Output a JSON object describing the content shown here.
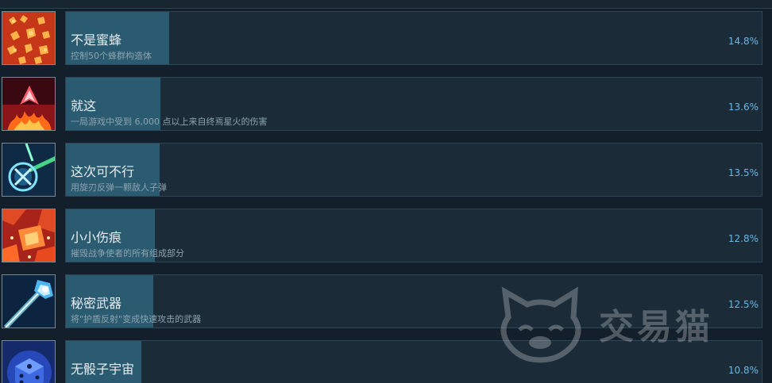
{
  "achievements": [
    {
      "name": "不是蜜蜂",
      "description": "控制50个蜂群构造体",
      "percent": "14.8%",
      "percent_value": 14.8,
      "icon": "swarm-icon",
      "icon_color": "#c8321e"
    },
    {
      "name": "就这",
      "description": "一局游戏中受到 6,000 点以上来自终焉星火的伤害",
      "percent": "13.6%",
      "percent_value": 13.6,
      "icon": "fire-icon",
      "icon_color": "#d02024"
    },
    {
      "name": "这次可不行",
      "description": "用旋刃反弹一颗敌人子弹",
      "percent": "13.5%",
      "percent_value": 13.5,
      "icon": "blade-reflect-icon",
      "icon_color": "#1f5e8c"
    },
    {
      "name": "小小伤痕",
      "description": "摧毁战争使者的所有组成部分",
      "percent": "12.8%",
      "percent_value": 12.8,
      "icon": "war-scar-icon",
      "icon_color": "#c4321c"
    },
    {
      "name": "秘密武器",
      "description": "将\"护盾反射\"变成快速攻击的武器",
      "percent": "12.5%",
      "percent_value": 12.5,
      "icon": "secret-weapon-icon",
      "icon_color": "#1d5e94"
    },
    {
      "name": "无骰子宇宙",
      "description": "",
      "percent": "10.8%",
      "percent_value": 10.8,
      "icon": "dice-icon",
      "icon_color": "#2846a8"
    }
  ],
  "watermark": {
    "text": "交易猫",
    "icon": "cat-logo-icon"
  }
}
